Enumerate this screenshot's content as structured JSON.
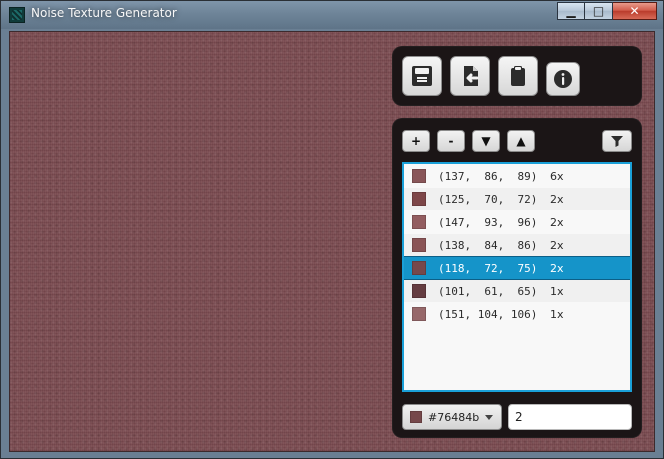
{
  "window": {
    "title": "Noise Texture Generator",
    "controls": {
      "minimize": "▁",
      "maximize": "□",
      "close": "✕"
    }
  },
  "toolbar": {
    "buttons": [
      {
        "name": "save",
        "icon": "floppy-disk-icon"
      },
      {
        "name": "export",
        "icon": "file-export-icon"
      },
      {
        "name": "clipboard",
        "icon": "clipboard-icon"
      },
      {
        "name": "info",
        "icon": "info-icon"
      }
    ]
  },
  "list_controls": {
    "add": "+",
    "remove": "-",
    "down": "▼",
    "up": "▲",
    "filter_icon": "filter-icon"
  },
  "colors": {
    "rows": [
      {
        "rgb_text": "(137,  86,  89)",
        "count": "6x",
        "hex": "#895659"
      },
      {
        "rgb_text": "(125,  70,  72)",
        "count": "2x",
        "hex": "#7d4648"
      },
      {
        "rgb_text": "(147,  93,  96)",
        "count": "2x",
        "hex": "#935d60"
      },
      {
        "rgb_text": "(138,  84,  86)",
        "count": "2x",
        "hex": "#8a5456"
      },
      {
        "rgb_text": "(118,  72,  75)",
        "count": "2x",
        "hex": "#76484b",
        "selected": true
      },
      {
        "rgb_text": "(101,  61,  65)",
        "count": "1x",
        "hex": "#653d41"
      },
      {
        "rgb_text": "(151, 104, 106)",
        "count": "1x",
        "hex": "#97686a"
      }
    ]
  },
  "bottom": {
    "selected_color_label": "#76484b",
    "selected_color_hex": "#76484b",
    "count_value": "2"
  }
}
